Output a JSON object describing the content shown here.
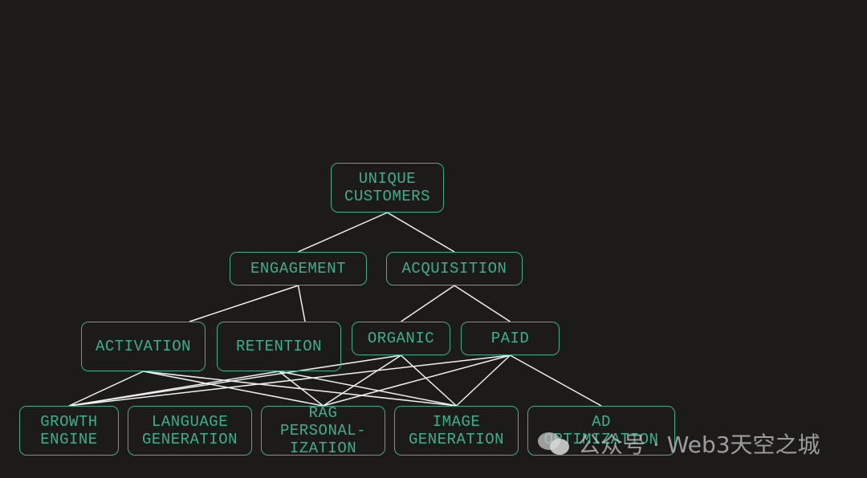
{
  "colors": {
    "background": "#1c1b1a",
    "node_border": "#3fae8c",
    "node_text": "#3fae8c",
    "edge": "#f0f0f0"
  },
  "nodes": [
    {
      "id": "unique",
      "lines": [
        "UNIQUE",
        "CUSTOMERS"
      ]
    },
    {
      "id": "engagement",
      "lines": [
        "ENGAGEMENT"
      ]
    },
    {
      "id": "acquisition",
      "lines": [
        "ACQUISITION"
      ]
    },
    {
      "id": "activation",
      "lines": [
        "ACTIVATION"
      ]
    },
    {
      "id": "retention",
      "lines": [
        "RETENTION"
      ]
    },
    {
      "id": "organic",
      "lines": [
        "ORGANIC"
      ]
    },
    {
      "id": "paid",
      "lines": [
        "PAID"
      ]
    },
    {
      "id": "growth",
      "lines": [
        "GROWTH",
        "ENGINE"
      ]
    },
    {
      "id": "language",
      "lines": [
        "LANGUAGE",
        "GENERATION"
      ]
    },
    {
      "id": "rag",
      "lines": [
        "RAG",
        "PERSONAL-",
        "IZATION"
      ]
    },
    {
      "id": "image",
      "lines": [
        "IMAGE",
        "GENERATION"
      ]
    },
    {
      "id": "ad",
      "lines": [
        "AD",
        "OPTIMIZATION"
      ]
    }
  ],
  "edges": [
    [
      "unique",
      "engagement"
    ],
    [
      "unique",
      "acquisition"
    ],
    [
      "engagement",
      "activation"
    ],
    [
      "engagement",
      "retention"
    ],
    [
      "acquisition",
      "organic"
    ],
    [
      "acquisition",
      "paid"
    ],
    [
      "activation",
      "growth"
    ],
    [
      "activation",
      "rag"
    ],
    [
      "activation",
      "image"
    ],
    [
      "retention",
      "growth"
    ],
    [
      "retention",
      "rag"
    ],
    [
      "retention",
      "image"
    ],
    [
      "organic",
      "growth"
    ],
    [
      "organic",
      "rag"
    ],
    [
      "organic",
      "image"
    ],
    [
      "paid",
      "growth"
    ],
    [
      "paid",
      "rag"
    ],
    [
      "paid",
      "image"
    ],
    [
      "paid",
      "ad"
    ]
  ],
  "watermark": {
    "text": "公众号 · Web3天空之城",
    "icon": "wechat-icon"
  }
}
